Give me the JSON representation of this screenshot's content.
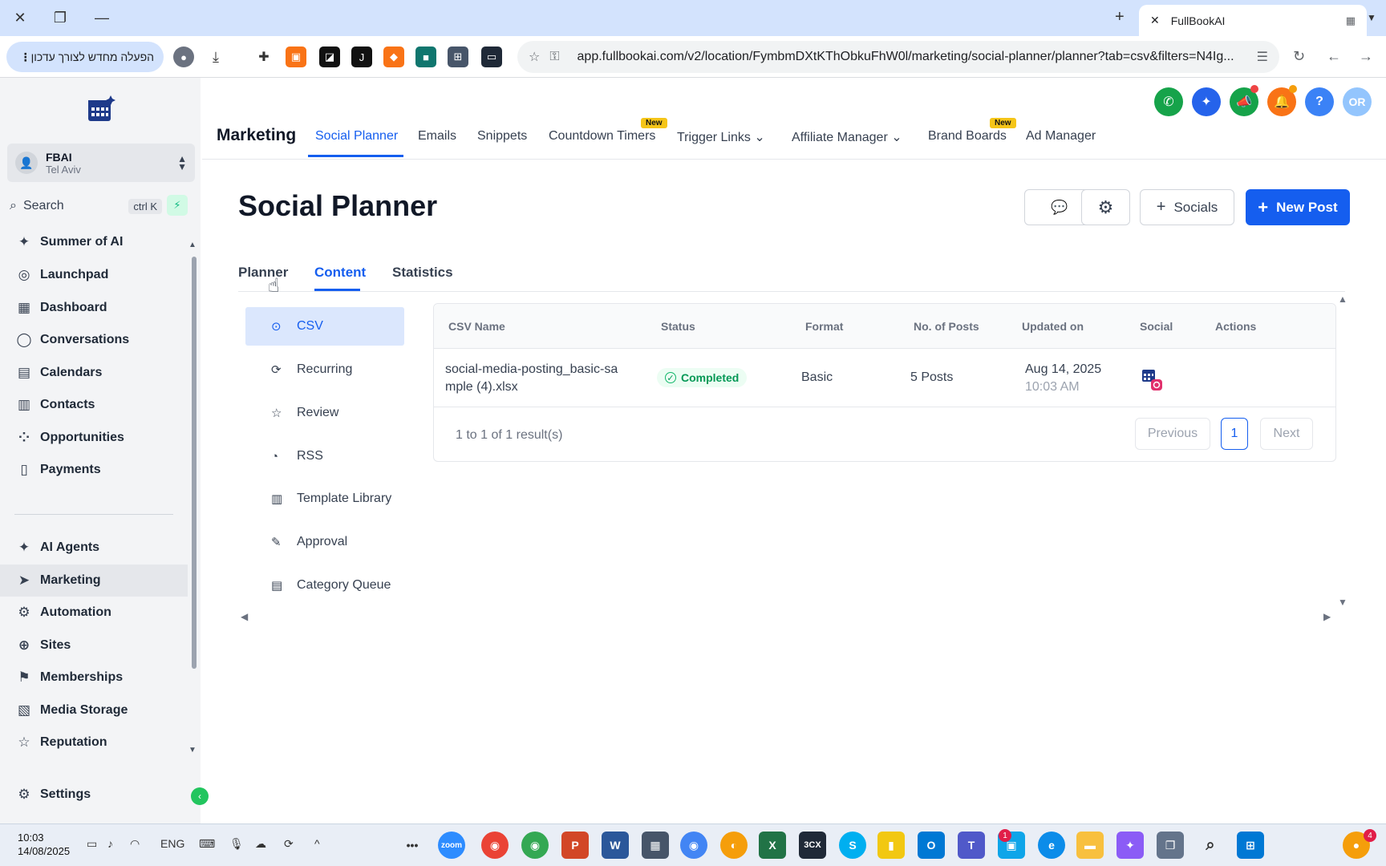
{
  "browser": {
    "tab_title": "FullBookAI",
    "restart_label": "הפעלה מחדש לצורך עדכון",
    "url": "app.fullbookai.com/v2/location/FymbmDXtKThObkuFhW0l/marketing/social-planner/planner?tab=csv&filters=N4Ig..."
  },
  "sidebar": {
    "account_name": "FBAI",
    "account_location": "Tel Aviv",
    "search_label": "Search",
    "search_shortcut": "ctrl K",
    "items": [
      {
        "label": "Summer of AI",
        "icon": "sparkle-icon"
      },
      {
        "label": "Launchpad",
        "icon": "rocket-icon"
      },
      {
        "label": "Dashboard",
        "icon": "dashboard-icon"
      },
      {
        "label": "Conversations",
        "icon": "chat-icon"
      },
      {
        "label": "Calendars",
        "icon": "calendar-icon"
      },
      {
        "label": "Contacts",
        "icon": "contacts-icon"
      },
      {
        "label": "Opportunities",
        "icon": "opportunities-icon"
      },
      {
        "label": "Payments",
        "icon": "payments-icon"
      },
      {
        "label": "AI Agents",
        "icon": "sparkle-icon"
      },
      {
        "label": "Marketing",
        "icon": "send-icon"
      },
      {
        "label": "Automation",
        "icon": "automation-icon"
      },
      {
        "label": "Sites",
        "icon": "globe-icon"
      },
      {
        "label": "Memberships",
        "icon": "memberships-icon"
      },
      {
        "label": "Media Storage",
        "icon": "image-icon"
      },
      {
        "label": "Reputation",
        "icon": "star-icon"
      }
    ],
    "settings_label": "Settings",
    "active_item": "Marketing"
  },
  "topnav": {
    "title": "Marketing",
    "items": [
      "Social Planner",
      "Emails",
      "Snippets",
      "Countdown Timers",
      "Trigger Links",
      "Affiliate Manager",
      "Brand Boards",
      "Ad Manager"
    ],
    "new_badge": "New",
    "avatar_initials": "OR",
    "help_label": "?"
  },
  "page": {
    "title": "Social Planner",
    "socials_button": "Socials",
    "new_post_button": "New Post",
    "tabs": [
      "Planner",
      "Content",
      "Statistics"
    ],
    "active_tab": "Content"
  },
  "submenu": {
    "items": [
      "CSV",
      "Recurring",
      "Review",
      "RSS",
      "Template Library",
      "Approval",
      "Category Queue"
    ],
    "active": "CSV"
  },
  "table": {
    "columns": [
      "CSV Name",
      "Status",
      "Format",
      "No. of Posts",
      "Updated on",
      "Social",
      "Actions"
    ],
    "rows": [
      {
        "name_line1": "social-media-posting_basic-sa",
        "name_line2": "mple (4).xlsx",
        "status": "Completed",
        "format": "Basic",
        "posts": "5 Posts",
        "date": "Aug 14, 2025",
        "time": "10:03 AM"
      }
    ],
    "result_info": "1 to 1 of 1 result(s)",
    "prev_label": "Previous",
    "page_number": "1",
    "next_label": "Next"
  },
  "taskbar": {
    "time": "10:03",
    "date": "14/08/2025",
    "lang": "ENG",
    "teams_badge": "1",
    "tray_badge": "4"
  },
  "colors": {
    "accent": "#155eef",
    "success": "#039855"
  }
}
